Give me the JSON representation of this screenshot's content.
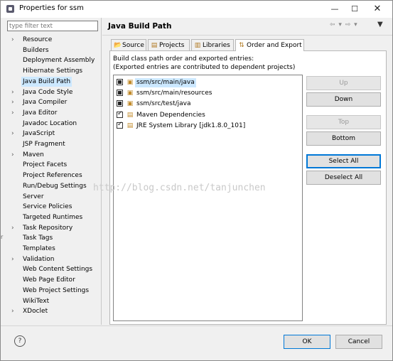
{
  "window": {
    "title": "Properties for ssm",
    "minimize": "—",
    "maximize": "☐",
    "close": "✕"
  },
  "sidebar": {
    "filter_placeholder": "type filter text",
    "items": [
      {
        "label": "Resource",
        "expandable": true
      },
      {
        "label": "Builders",
        "expandable": false
      },
      {
        "label": "Deployment Assembly",
        "expandable": false
      },
      {
        "label": "Hibernate Settings",
        "expandable": false
      },
      {
        "label": "Java Build Path",
        "expandable": false,
        "selected": true
      },
      {
        "label": "Java Code Style",
        "expandable": true
      },
      {
        "label": "Java Compiler",
        "expandable": true
      },
      {
        "label": "Java Editor",
        "expandable": true
      },
      {
        "label": "Javadoc Location",
        "expandable": false
      },
      {
        "label": "JavaScript",
        "expandable": true
      },
      {
        "label": "JSP Fragment",
        "expandable": false
      },
      {
        "label": "Maven",
        "expandable": true
      },
      {
        "label": "Project Facets",
        "expandable": false
      },
      {
        "label": "Project References",
        "expandable": false
      },
      {
        "label": "Run/Debug Settings",
        "expandable": false
      },
      {
        "label": "Server",
        "expandable": false
      },
      {
        "label": "Service Policies",
        "expandable": false
      },
      {
        "label": "Targeted Runtimes",
        "expandable": false
      },
      {
        "label": "Task Repository",
        "expandable": true
      },
      {
        "label": "Task Tags",
        "expandable": false
      },
      {
        "label": "Templates",
        "expandable": false
      },
      {
        "label": "Validation",
        "expandable": true
      },
      {
        "label": "Web Content Settings",
        "expandable": false
      },
      {
        "label": "Web Page Editor",
        "expandable": false
      },
      {
        "label": "Web Project Settings",
        "expandable": false
      },
      {
        "label": "WikiText",
        "expandable": false
      },
      {
        "label": "XDoclet",
        "expandable": true
      }
    ]
  },
  "page": {
    "title": "Java Build Path",
    "nav_arrows": "⇦ ▾ ⇨ ▾",
    "menu_arrow": "▼"
  },
  "tabs": [
    {
      "label": "Source",
      "icon": "folder-icon"
    },
    {
      "label": "Projects",
      "icon": "projects-icon"
    },
    {
      "label": "Libraries",
      "icon": "libraries-icon"
    },
    {
      "label": "Order and Export",
      "icon": "order-export-icon",
      "active": true
    }
  ],
  "order": {
    "description_line1": "Build class path order and exported entries:",
    "description_line2": "(Exported entries are contributed to dependent projects)",
    "entries": [
      {
        "label": "ssm/src/main/java",
        "state": "partial",
        "selected": true,
        "icon": "source-folder-icon"
      },
      {
        "label": "ssm/src/main/resources",
        "state": "partial",
        "icon": "source-folder-icon"
      },
      {
        "label": "ssm/src/test/java",
        "state": "partial",
        "icon": "source-folder-icon"
      },
      {
        "label": "Maven Dependencies",
        "state": "checked",
        "icon": "library-icon"
      },
      {
        "label": "JRE System Library [jdk1.8.0_101]",
        "state": "checked",
        "icon": "library-icon"
      }
    ],
    "buttons": {
      "up": "Up",
      "down": "Down",
      "top": "Top",
      "bottom": "Bottom",
      "select_all": "Select All",
      "deselect_all": "Deselect All"
    }
  },
  "watermark": "http://blog.csdn.net/tanjunchen",
  "footer": {
    "help": "?",
    "ok": "OK",
    "cancel": "Cancel"
  },
  "edge_mark": "r"
}
